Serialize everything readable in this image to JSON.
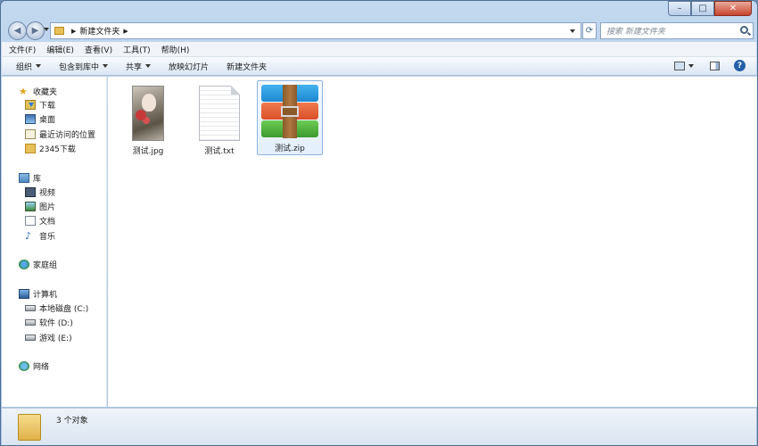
{
  "window": {
    "controls": {
      "minimize": "–",
      "maximize": "□",
      "close": "✕"
    }
  },
  "address": {
    "path": "新建文件夹",
    "search_placeholder": "搜索 新建文件夹"
  },
  "menu": [
    "文件(F)",
    "编辑(E)",
    "查看(V)",
    "工具(T)",
    "帮助(H)"
  ],
  "toolbar": {
    "organize": "组织",
    "include_in_library": "包含到库中",
    "share": "共享",
    "slideshow": "放映幻灯片",
    "new_folder": "新建文件夹"
  },
  "sidebar": {
    "favorites": "收藏夹",
    "downloads": "下载",
    "desktop": "桌面",
    "recent": "最近访问的位置",
    "downloads2345": "2345下载",
    "libraries": "库",
    "video": "视频",
    "pictures": "图片",
    "documents": "文档",
    "music": "音乐",
    "homegroup": "家庭组",
    "computer": "计算机",
    "disk_c": "本地磁盘 (C:)",
    "disk_d": "软件 (D:)",
    "disk_e": "游戏 (E:)",
    "network": "网络"
  },
  "files": [
    {
      "name": "测试.jpg",
      "icon": "image-thumbnail"
    },
    {
      "name": "测试.txt",
      "icon": "text-document-icon"
    },
    {
      "name": "测试.zip",
      "icon": "winrar-archive-icon",
      "selected": true
    }
  ],
  "status": {
    "count": "3 个对象"
  }
}
